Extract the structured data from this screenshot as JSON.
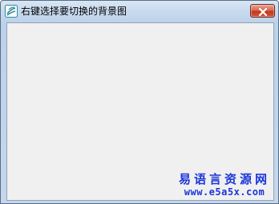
{
  "window": {
    "title": "右键选择要切换的背景图",
    "app_icon": "app-logo-icon",
    "close_icon": "close-icon"
  },
  "watermark": {
    "line1": "易语言资源网",
    "line2": "www.e5a5x.com"
  },
  "colors": {
    "client_background": "#f0f0f0",
    "close_button": "#c2391f",
    "watermark_text": "#1b36d8"
  }
}
